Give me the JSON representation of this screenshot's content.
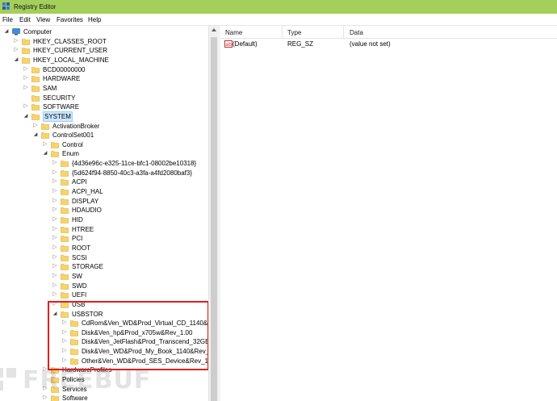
{
  "window": {
    "title": "Registry Editor",
    "accent": "#a4cf5b"
  },
  "menu": [
    "File",
    "Edit",
    "View",
    "Favorites",
    "Help"
  ],
  "tree": {
    "selected": "SYSTEM",
    "highlight_color": "#e02020",
    "nodes": [
      {
        "label": "Computer",
        "depth": 0,
        "toggle": "expanded",
        "icon": "computer-icon"
      },
      {
        "label": "HKEY_CLASSES_ROOT",
        "depth": 1,
        "toggle": "collapsed",
        "icon": "folder-icon"
      },
      {
        "label": "HKEY_CURRENT_USER",
        "depth": 1,
        "toggle": "collapsed",
        "icon": "folder-icon"
      },
      {
        "label": "HKEY_LOCAL_MACHINE",
        "depth": 1,
        "toggle": "expanded",
        "icon": "folder-icon"
      },
      {
        "label": "BCD00000000",
        "depth": 2,
        "toggle": "collapsed",
        "icon": "folder-icon"
      },
      {
        "label": "HARDWARE",
        "depth": 2,
        "toggle": "collapsed",
        "icon": "folder-icon"
      },
      {
        "label": "SAM",
        "depth": 2,
        "toggle": "collapsed",
        "icon": "folder-icon"
      },
      {
        "label": "SECURITY",
        "depth": 2,
        "toggle": "none",
        "icon": "folder-icon"
      },
      {
        "label": "SOFTWARE",
        "depth": 2,
        "toggle": "collapsed",
        "icon": "folder-icon"
      },
      {
        "label": "SYSTEM",
        "depth": 2,
        "toggle": "expanded",
        "icon": "folder-icon",
        "selected": true
      },
      {
        "label": "ActivationBroker",
        "depth": 3,
        "toggle": "collapsed",
        "icon": "folder-icon"
      },
      {
        "label": "ControlSet001",
        "depth": 3,
        "toggle": "expanded",
        "icon": "folder-icon"
      },
      {
        "label": "Control",
        "depth": 4,
        "toggle": "collapsed",
        "icon": "folder-icon"
      },
      {
        "label": "Enum",
        "depth": 4,
        "toggle": "expanded",
        "icon": "folder-icon"
      },
      {
        "label": "{4d36e96c-e325-11ce-bfc1-08002be10318}",
        "depth": 5,
        "toggle": "collapsed",
        "icon": "folder-icon"
      },
      {
        "label": "{5d624f94-8850-40c3-a3fa-a4fd2080baf3}",
        "depth": 5,
        "toggle": "collapsed",
        "icon": "folder-icon"
      },
      {
        "label": "ACPI",
        "depth": 5,
        "toggle": "collapsed",
        "icon": "folder-icon"
      },
      {
        "label": "ACPI_HAL",
        "depth": 5,
        "toggle": "collapsed",
        "icon": "folder-icon"
      },
      {
        "label": "DISPLAY",
        "depth": 5,
        "toggle": "collapsed",
        "icon": "folder-icon"
      },
      {
        "label": "HDAUDIO",
        "depth": 5,
        "toggle": "collapsed",
        "icon": "folder-icon"
      },
      {
        "label": "HID",
        "depth": 5,
        "toggle": "collapsed",
        "icon": "folder-icon"
      },
      {
        "label": "HTREE",
        "depth": 5,
        "toggle": "collapsed",
        "icon": "folder-icon"
      },
      {
        "label": "PCI",
        "depth": 5,
        "toggle": "collapsed",
        "icon": "folder-icon"
      },
      {
        "label": "ROOT",
        "depth": 5,
        "toggle": "collapsed",
        "icon": "folder-icon"
      },
      {
        "label": "SCSI",
        "depth": 5,
        "toggle": "collapsed",
        "icon": "folder-icon"
      },
      {
        "label": "STORAGE",
        "depth": 5,
        "toggle": "collapsed",
        "icon": "folder-icon"
      },
      {
        "label": "SW",
        "depth": 5,
        "toggle": "collapsed",
        "icon": "folder-icon"
      },
      {
        "label": "SWD",
        "depth": 5,
        "toggle": "collapsed",
        "icon": "folder-icon"
      },
      {
        "label": "UEFI",
        "depth": 5,
        "toggle": "collapsed",
        "icon": "folder-icon"
      },
      {
        "label": "USB",
        "depth": 5,
        "toggle": "collapsed",
        "icon": "folder-icon"
      },
      {
        "label": "USBSTOR",
        "depth": 5,
        "toggle": "expanded",
        "icon": "folder-icon"
      },
      {
        "label": "CdRom&Ven_WD&Prod_Virtual_CD_1140&Rev",
        "depth": 6,
        "toggle": "collapsed",
        "icon": "folder-icon"
      },
      {
        "label": "Disk&Ven_hp&Prod_x705w&Rev_1.00",
        "depth": 6,
        "toggle": "collapsed",
        "icon": "folder-icon"
      },
      {
        "label": "Disk&Ven_JetFlash&Prod_Transcend_32GB&Re",
        "depth": 6,
        "toggle": "collapsed",
        "icon": "folder-icon"
      },
      {
        "label": "Disk&Ven_WD&Prod_My_Book_1140&Rev_10",
        "depth": 6,
        "toggle": "collapsed",
        "icon": "folder-icon"
      },
      {
        "label": "Other&Ven_WD&Prod_SES_Device&Rev_1010",
        "depth": 6,
        "toggle": "collapsed",
        "icon": "folder-icon"
      },
      {
        "label": "HardwareProfiles",
        "depth": 4,
        "toggle": "collapsed",
        "icon": "folder-icon"
      },
      {
        "label": "Policies",
        "depth": 4,
        "toggle": "none",
        "icon": "folder-icon"
      },
      {
        "label": "Services",
        "depth": 4,
        "toggle": "collapsed",
        "icon": "folder-icon"
      },
      {
        "label": "Software",
        "depth": 4,
        "toggle": "collapsed",
        "icon": "folder-icon"
      }
    ]
  },
  "values": {
    "columns": [
      "Name",
      "Type",
      "Data"
    ],
    "rows": [
      {
        "name": "(Default)",
        "type": "REG_SZ",
        "data": "(value not set)",
        "icon": "string-value-icon"
      }
    ]
  },
  "watermark": {
    "text": "FREEBUF",
    "icon": "freebuf-logo-icon"
  }
}
